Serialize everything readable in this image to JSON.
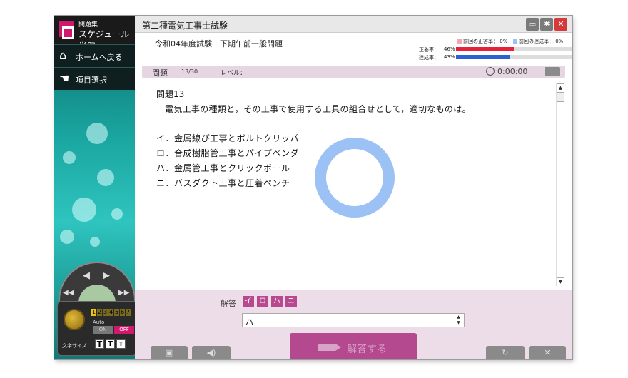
{
  "sidebar": {
    "logo_small": "問題集",
    "logo_big": "スケジュール学習",
    "items": [
      {
        "label": "ホームへ戻る",
        "icon": "home-icon"
      },
      {
        "label": "項目選択",
        "icon": "pointer-icon"
      }
    ],
    "controls": {
      "speed_digits": [
        "1",
        "2",
        "3",
        "4",
        "5",
        "6",
        "7"
      ],
      "speed_selected": "1",
      "auto_label": "Auto",
      "on_label": "ON",
      "off_label": "OFF",
      "font_size_label": "文字サイズ",
      "font_sizes": [
        "T",
        "T",
        "T"
      ]
    }
  },
  "header": {
    "title": "第二種電気工事士試験",
    "exam_name": "令和04年度試験　下期午前一般問題",
    "stats": {
      "correct_label": "正答率：",
      "correct_value": "46%",
      "correct_fraction": 0.46,
      "achieve_label": "達成率：",
      "achieve_value": "43%",
      "achieve_fraction": 0.43,
      "legend_prev_correct": "前回の正答率：",
      "legend_prev_correct_value": "0%",
      "legend_prev_achieve": "前回の達成率：",
      "legend_prev_achieve_value": "0%"
    },
    "colors": {
      "correct": "#e8213a",
      "achieve": "#2a61d4",
      "accent": "#b5498f"
    }
  },
  "question_bar": {
    "label": "問題",
    "number": "13/30",
    "level_label": "レベル：",
    "timer": "0:00:00"
  },
  "question": {
    "title": "問題13",
    "text": "電気工事の種類と，その工事で使用する工具の組合せとして，適切なものは。",
    "choices": [
      "イ．金属線ぴ工事とボルトクリッパ",
      "ロ．合成樹脂管工事とパイプベンダ",
      "ハ．金属管工事とクリックボール",
      "ニ．バスダクト工事と圧着ペンチ"
    ]
  },
  "answer": {
    "label": "解答",
    "options": [
      "イ",
      "ロ",
      "ハ",
      "ニ"
    ],
    "input_value": "ハ",
    "submit_label": "解答する"
  }
}
